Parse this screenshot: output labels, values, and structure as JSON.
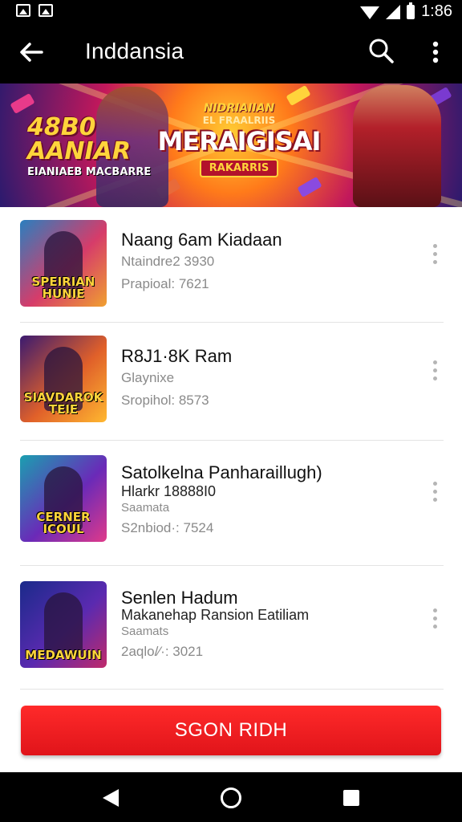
{
  "status_bar": {
    "time": "1:86"
  },
  "app_bar": {
    "title": "Inddansia"
  },
  "banner": {
    "left_title_line1": "48B0",
    "left_title_line2": "AANIAR",
    "left_subtitle": "EIANIAEB MACBARRE",
    "center_line1": "NIDRIAIIAN",
    "center_line2": "EL FRAALRIIS",
    "center_title": "MERAIGISAI",
    "center_badge": "RAKARRIS"
  },
  "items": [
    {
      "title": "Naang 6am Kiadaan",
      "subtitle": "Ntaindre2 3930",
      "meta": "Prapioal: 7621",
      "thumb_label": "SPEIRIAN HUNIE",
      "thumb_colors": [
        "#2a7fbf",
        "#d63c6a",
        "#f0a030"
      ]
    },
    {
      "title": "R8J1·8K Ram",
      "subtitle": "Glaynixe",
      "meta": "Sropihol: 8573",
      "thumb_label": "SIAVDAROK TEIE",
      "thumb_colors": [
        "#3a1a70",
        "#e0602a",
        "#ffb830"
      ]
    },
    {
      "title": "Satolkelna Panharaillugh)",
      "subtitle": "Hlarkr 18888I0",
      "meta": "S2nbiod·: 7524",
      "thumb_label": "CERNER ICOUL",
      "thumb_colors": [
        "#1aa0b0",
        "#6a2ab8",
        "#e03a8a"
      ]
    },
    {
      "title": "Senlen Hadum",
      "subtitle": "Makanehap Ransion Eatiliam",
      "subtitle2": "Saamats",
      "meta": "2aqlo/⁄·: 3021",
      "thumb_label": "MEDAWUIN",
      "thumb_colors": [
        "#1a2a8a",
        "#5a2ab0",
        "#c02a6a"
      ]
    }
  ],
  "cta": {
    "label": "SGON RIDH"
  },
  "colors": {
    "accent": "#e8161c",
    "app_bar": "#000000"
  }
}
